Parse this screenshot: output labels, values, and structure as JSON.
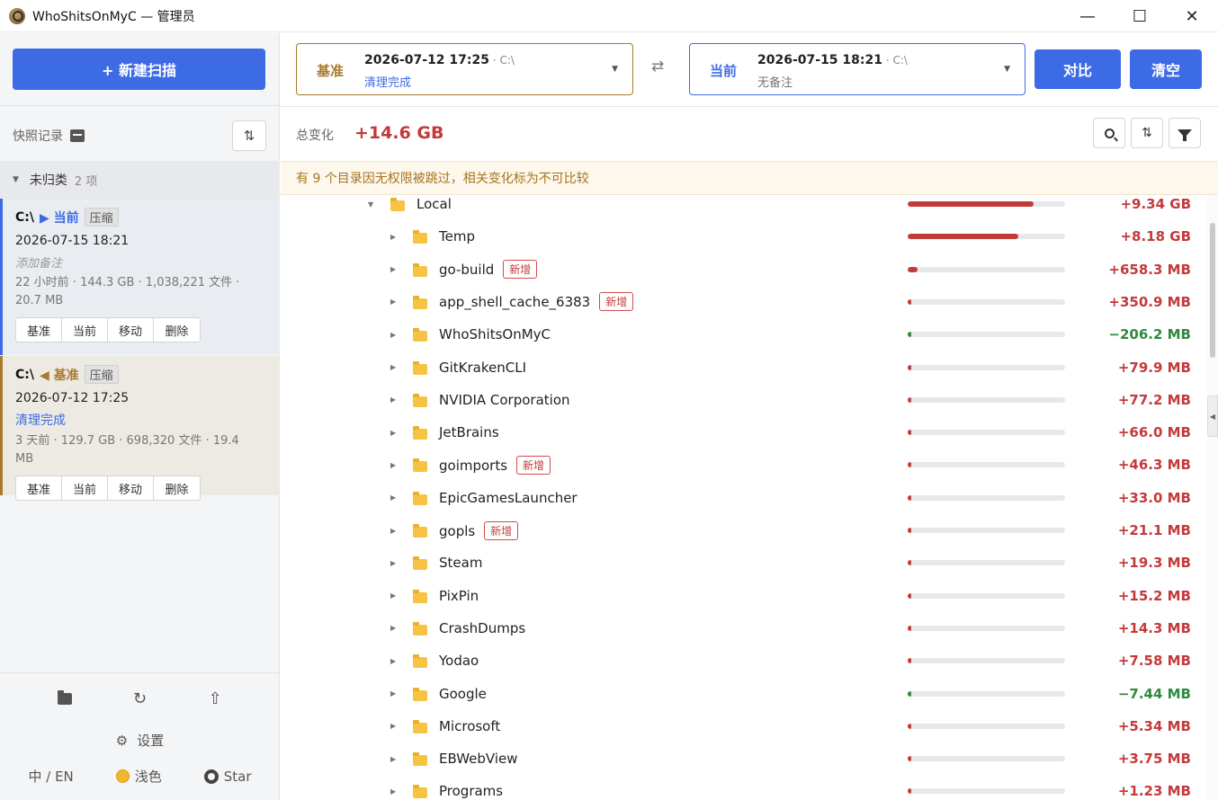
{
  "window": {
    "title": "WhoShitsOnMyC — 管理员",
    "minimize": "—",
    "maximize": "☐",
    "close": "✕"
  },
  "sidebar": {
    "new_scan_label": "+ 新建扫描",
    "snapshots_label": "快照记录",
    "group": {
      "name": "未归类",
      "count": "2 项"
    },
    "cards": [
      {
        "drive": "C:\\",
        "role_icon": "▶",
        "role": "当前",
        "compress": "压缩",
        "date": "2026-07-15 18:21",
        "note": "添加备注",
        "meta": "22 小时前 · 144.3 GB · 1,038,221 文件 · 20.7 MB",
        "actions": [
          "基准",
          "当前",
          "移动",
          "删除"
        ]
      },
      {
        "drive": "C:\\",
        "role_icon": "◀",
        "role": "基准",
        "compress": "压缩",
        "date": "2026-07-12 17:25",
        "status": "清理完成",
        "meta": "3 天前 · 129.7 GB · 698,320 文件 · 19.4 MB",
        "actions": [
          "基准",
          "当前",
          "移动",
          "删除"
        ]
      }
    ],
    "settings_label": "设置",
    "lang_label": "中 / EN",
    "theme_label": "浅色",
    "star_label": "Star"
  },
  "compare": {
    "base": {
      "tag": "基准",
      "date": "2026-07-12 17:25",
      "drive": " · C:\\",
      "sub": "清理完成"
    },
    "current": {
      "tag": "当前",
      "date": "2026-07-15 18:21",
      "drive": " · C:\\",
      "sub": "无备注"
    },
    "swap_icon": "⇄",
    "compare_button": "对比",
    "clear_button": "清空"
  },
  "summary": {
    "total_label": "总变化",
    "total_value": "+14.6 GB",
    "warning": "有 9 个目录因无权限被跳过，相关变化标为不可比较"
  },
  "badge_new": "新增",
  "tree": [
    {
      "name": "Local",
      "level": 0,
      "expanded": true,
      "new": false,
      "delta": "+9.34 GB",
      "sign": "pos",
      "ratio": 0.8
    },
    {
      "name": "Temp",
      "level": 1,
      "expanded": false,
      "new": false,
      "delta": "+8.18 GB",
      "sign": "pos",
      "ratio": 0.7
    },
    {
      "name": "go-build",
      "level": 1,
      "expanded": false,
      "new": true,
      "delta": "+658.3 MB",
      "sign": "pos",
      "ratio": 0.06
    },
    {
      "name": "app_shell_cache_6383",
      "level": 1,
      "expanded": false,
      "new": true,
      "delta": "+350.9 MB",
      "sign": "pos",
      "ratio": 0.025
    },
    {
      "name": "WhoShitsOnMyC",
      "level": 1,
      "expanded": false,
      "new": false,
      "delta": "−206.2 MB",
      "sign": "neg",
      "ratio": 0.02
    },
    {
      "name": "GitKrakenCLI",
      "level": 1,
      "expanded": false,
      "new": false,
      "delta": "+79.9 MB",
      "sign": "pos",
      "ratio": 0.015
    },
    {
      "name": "NVIDIA Corporation",
      "level": 1,
      "expanded": false,
      "new": false,
      "delta": "+77.2 MB",
      "sign": "pos",
      "ratio": 0.015
    },
    {
      "name": "JetBrains",
      "level": 1,
      "expanded": false,
      "new": false,
      "delta": "+66.0 MB",
      "sign": "pos",
      "ratio": 0.015
    },
    {
      "name": "goimports",
      "level": 1,
      "expanded": false,
      "new": true,
      "delta": "+46.3 MB",
      "sign": "pos",
      "ratio": 0.015
    },
    {
      "name": "EpicGamesLauncher",
      "level": 1,
      "expanded": false,
      "new": false,
      "delta": "+33.0 MB",
      "sign": "pos",
      "ratio": 0.015
    },
    {
      "name": "gopls",
      "level": 1,
      "expanded": false,
      "new": true,
      "delta": "+21.1 MB",
      "sign": "pos",
      "ratio": 0.015
    },
    {
      "name": "Steam",
      "level": 1,
      "expanded": false,
      "new": false,
      "delta": "+19.3 MB",
      "sign": "pos",
      "ratio": 0.015
    },
    {
      "name": "PixPin",
      "level": 1,
      "expanded": false,
      "new": false,
      "delta": "+15.2 MB",
      "sign": "pos",
      "ratio": 0.015
    },
    {
      "name": "CrashDumps",
      "level": 1,
      "expanded": false,
      "new": false,
      "delta": "+14.3 MB",
      "sign": "pos",
      "ratio": 0.015
    },
    {
      "name": "Yodao",
      "level": 1,
      "expanded": false,
      "new": false,
      "delta": "+7.58 MB",
      "sign": "pos",
      "ratio": 0.015
    },
    {
      "name": "Google",
      "level": 1,
      "expanded": false,
      "new": false,
      "delta": "−7.44 MB",
      "sign": "neg",
      "ratio": 0.015
    },
    {
      "name": "Microsoft",
      "level": 1,
      "expanded": false,
      "new": false,
      "delta": "+5.34 MB",
      "sign": "pos",
      "ratio": 0.015
    },
    {
      "name": "EBWebView",
      "level": 1,
      "expanded": false,
      "new": false,
      "delta": "+3.75 MB",
      "sign": "pos",
      "ratio": 0.015
    },
    {
      "name": "Programs",
      "level": 1,
      "expanded": false,
      "new": false,
      "delta": "+1.23 MB",
      "sign": "pos",
      "ratio": 0.015
    }
  ]
}
